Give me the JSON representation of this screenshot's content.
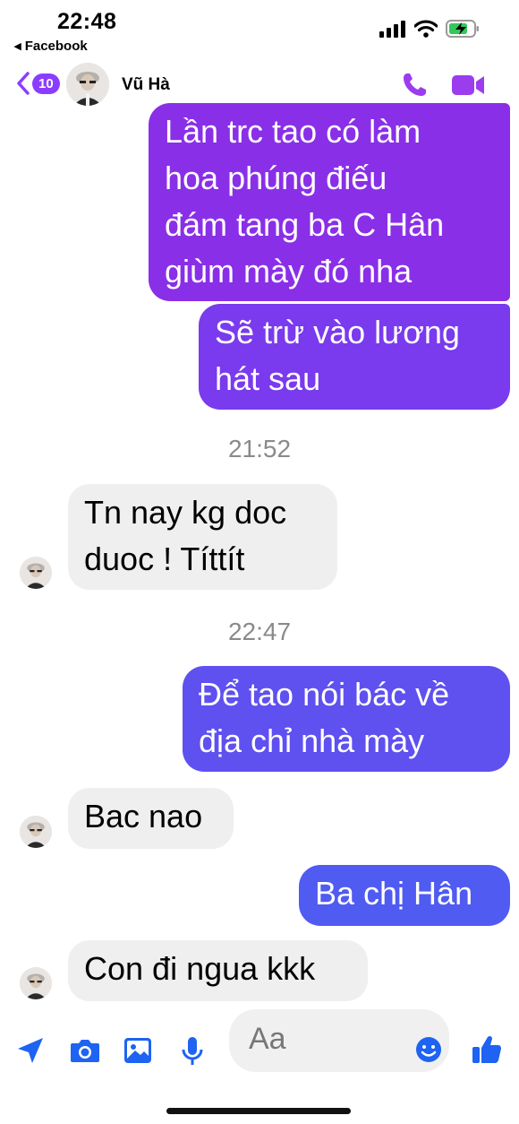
{
  "status_bar": {
    "time": "22:48",
    "back_app": "◂ Facebook"
  },
  "header": {
    "unread_count": "10",
    "contact_name": "Vũ Hà",
    "accent": "#9b3dee"
  },
  "messages": [
    {
      "direction": "outgoing",
      "text": "Lần trc tao có làm\nhoa phúng điếu\nđám tang ba C Hân\ngiùm mày đó nha"
    },
    {
      "direction": "outgoing",
      "text": "Sẽ trừ vào lương\nhát sau"
    },
    {
      "direction": "timestamp",
      "text": "21:52"
    },
    {
      "direction": "incoming",
      "text": "Tn nay kg doc\nduoc ! Títtít"
    },
    {
      "direction": "timestamp",
      "text": "22:47"
    },
    {
      "direction": "outgoing",
      "text": "Để tao nói bác về\nđịa chỉ nhà mày"
    },
    {
      "direction": "incoming",
      "text": "Bac nao"
    },
    {
      "direction": "outgoing",
      "text": "Ba chị Hân"
    },
    {
      "direction": "incoming",
      "text": "Con đi ngua kkk"
    }
  ],
  "composer": {
    "placeholder": "Aa",
    "icon_color": "#1e63f2"
  },
  "colors": {
    "bubble_purple": "#8a2fe8",
    "bubble_violet": "#6f44f0",
    "bubble_blue": "#4f5bf1",
    "incoming_gray": "#efefef"
  }
}
